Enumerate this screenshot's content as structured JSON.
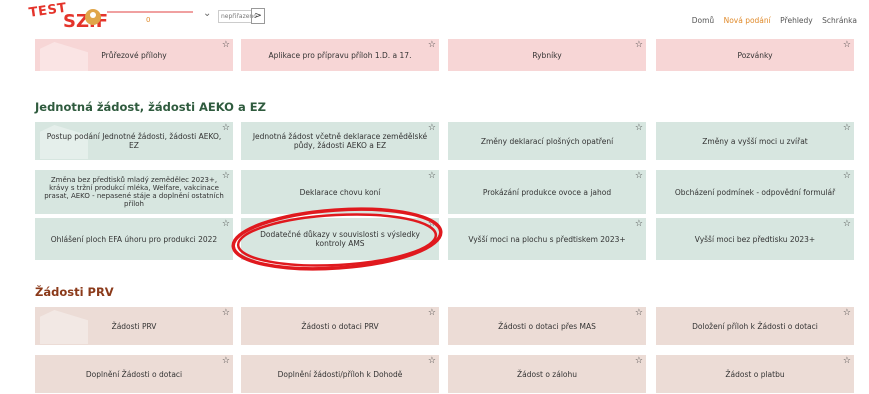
{
  "header": {
    "logo_test": "TEST",
    "logo_szif": "SZIF",
    "user_count": "0",
    "select_placeholder": "nepřiřazeno",
    "go_symbol": ">",
    "nav": [
      "Domů",
      "Nová podání",
      "Přehledy",
      "Schránka"
    ]
  },
  "row0": [
    "Průřezové přílohy",
    "Aplikace pro přípravu příloh 1.D. a 17.",
    "Rybníky",
    "Pozvánky"
  ],
  "section1": {
    "title": "Jednotná žádost, žádosti AEKO a EZ",
    "row1": [
      "Postup podání Jednotné žádosti, žádosti AEKO, EZ",
      "Jednotná žádost včetně deklarace zemědělské půdy, žádosti AEKO a EZ",
      "Změny deklarací plošných opatření",
      "Změny a vyšší moci u zvířat"
    ],
    "row2": [
      "Změna bez předtisků mladý zemědělec 2023+, krávy s tržní produkcí mléka, Welfare, vakcinace prasat, AEKO - nepasené stáje a doplnění ostatních příloh",
      "Deklarace chovu koní",
      "Prokázání produkce ovoce a jahod",
      "Obcházení podmínek - odpovědní formulář"
    ],
    "row3": [
      "Ohlášení ploch EFA úhoru pro produkci 2022",
      "Dodatečné důkazy v souvislosti s výsledky kontroly AMS",
      "Vyšší moci na plochu s předtiskem 2023+",
      "Vyšší moci bez předtisku 2023+"
    ]
  },
  "section2": {
    "title": "Žádosti PRV",
    "row1": [
      "Žádosti PRV",
      "Žádosti o dotaci PRV",
      "Žádosti o dotaci přes MAS",
      "Doložení příloh k Žádosti o dotaci"
    ],
    "row2": [
      "Doplnění Žádosti o dotaci",
      "Doplnění žádosti/příloh k Dohodě",
      "Žádost o zálohu",
      "Žádost o platbu"
    ]
  },
  "star": "☆",
  "colors": {
    "pink": "#f7d6d6",
    "green": "#d7e6e0",
    "rose": "#ecdcd6",
    "accent": "#e4342b",
    "highlight_oval": "#e0191e"
  },
  "annotation": "red hand-drawn oval around the Dodatečné důkazy tile"
}
